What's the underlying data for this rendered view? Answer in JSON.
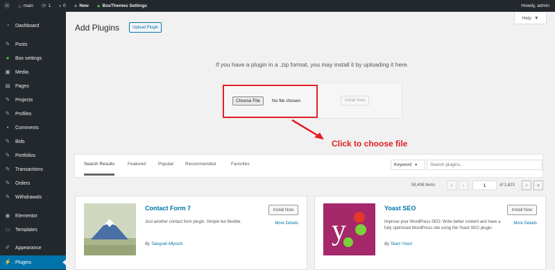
{
  "admin_bar": {
    "site_name": "main",
    "updates_count": "1",
    "comments_count": "0",
    "new_label": "New",
    "settings_label": "BoxThemes Settings",
    "greeting": "Howdy, admin"
  },
  "sidebar": {
    "items": [
      {
        "label": "Dashboard",
        "icon": "dashboard-icon"
      },
      {
        "label": "Posts",
        "icon": "pin-icon"
      },
      {
        "label": "Box settings",
        "icon": "circle-icon"
      },
      {
        "label": "Media",
        "icon": "media-icon"
      },
      {
        "label": "Pages",
        "icon": "pages-icon"
      },
      {
        "label": "Projects",
        "icon": "pin-icon"
      },
      {
        "label": "Profiles",
        "icon": "pin-icon"
      },
      {
        "label": "Comments",
        "icon": "comment-icon"
      },
      {
        "label": "Bids",
        "icon": "pin-icon"
      },
      {
        "label": "Portfolios",
        "icon": "pin-icon"
      },
      {
        "label": "Transactions",
        "icon": "pin-icon"
      },
      {
        "label": "Orders",
        "icon": "pin-icon"
      },
      {
        "label": "Withdrawals",
        "icon": "pin-icon"
      },
      {
        "label": "Elementor",
        "icon": "elementor-icon"
      },
      {
        "label": "Templates",
        "icon": "folder-icon"
      },
      {
        "label": "Appearance",
        "icon": "brush-icon"
      },
      {
        "label": "Plugins",
        "icon": "plug-icon"
      }
    ],
    "current": "Plugins"
  },
  "help": {
    "label": "Help"
  },
  "header": {
    "title": "Add Plugins",
    "upload_label": "Upload Plugin"
  },
  "upload": {
    "instruction": "If you have a plugin in a .zip format, you may install it by uploading it here.",
    "choose_file_label": "Choose File",
    "no_file_text": "No file chosen",
    "install_label": "Install Now"
  },
  "annotation": {
    "text": "Click to choose file",
    "color": "#e31e24"
  },
  "filter": {
    "tabs": [
      "Search Results",
      "Featured",
      "Popular",
      "Recommended",
      "Favorites"
    ],
    "active_tab": "Search Results",
    "keyword_label": "Keyword",
    "search_placeholder": "Search plugins..."
  },
  "pagination": {
    "items_text": "58,406 items",
    "first": "«",
    "prev": "‹",
    "current_page": "1",
    "of_text": "of 1,623",
    "next": "›",
    "last": "»"
  },
  "plugins": [
    {
      "name": "Contact Form 7",
      "install_label": "Install Now",
      "more_label": "More Details",
      "description": "Just another contact form plugin. Simple but flexible.",
      "author_prefix": "By",
      "author": "Takayuki Miyoshi"
    },
    {
      "name": "Yoast SEO",
      "install_label": "Install Now",
      "more_label": "More Details",
      "description": "Improve your WordPress SEO: Write better content and have a fully optimized WordPress site using the Yoast SEO plugin.",
      "author_prefix": "By",
      "author": "Team Yoast"
    }
  ],
  "colors": {
    "accent": "#0073aa",
    "sidebar_bg": "#23282d",
    "yoast_purple": "#a4286a"
  }
}
